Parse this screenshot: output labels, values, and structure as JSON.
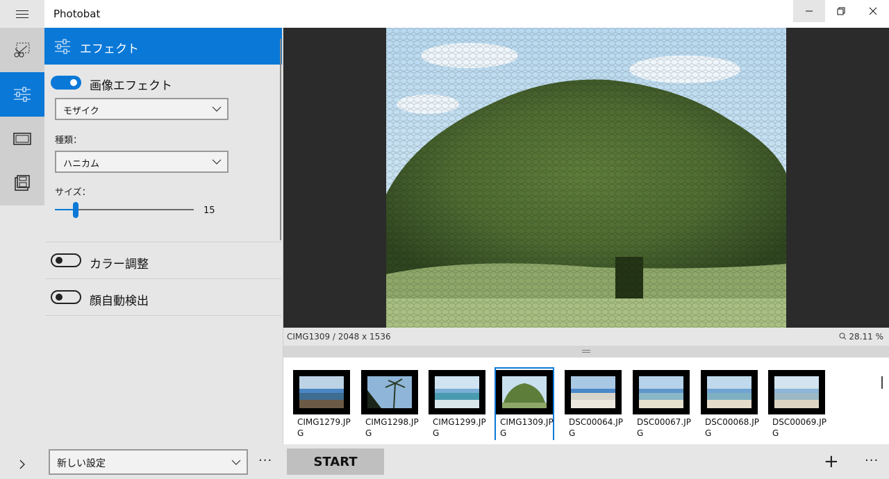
{
  "app": {
    "title": "Photobat"
  },
  "window_controls": {
    "minimize": "—",
    "restore": "❐",
    "close": "✕"
  },
  "rail": {
    "items": [
      {
        "name": "crop",
        "icon": "crop-icon",
        "active": false
      },
      {
        "name": "effects",
        "icon": "sliders-icon",
        "active": true
      },
      {
        "name": "frame",
        "icon": "frame-icon",
        "active": false
      },
      {
        "name": "save",
        "icon": "save-icon",
        "active": false
      }
    ],
    "expand_icon": "›"
  },
  "panel": {
    "header": "エフェクト",
    "image_effect": {
      "label": "画像エフェクト",
      "enabled": true,
      "effect_select": "モザイク",
      "type_label": "種類：",
      "type_select": "ハニカム",
      "size_label": "サイズ：",
      "size_value": "15",
      "size_level": 0.15
    },
    "color_adjust": {
      "label": "カラー調整",
      "enabled": false
    },
    "face_detect": {
      "label": "顔自動検出",
      "enabled": false
    }
  },
  "preset": {
    "value": "新しい設定",
    "more": "···"
  },
  "preview": {
    "info": "CIMG1309 / 2048 x 1536",
    "zoom": "28.11 %"
  },
  "filmstrip": {
    "items": [
      {
        "name_l1": "CIMG1279.JP",
        "name_l2": "G",
        "selected": false
      },
      {
        "name_l1": "CIMG1298.JP",
        "name_l2": "G",
        "selected": false
      },
      {
        "name_l1": "CIMG1299.JP",
        "name_l2": "G",
        "selected": false
      },
      {
        "name_l1": "CIMG1309.JP",
        "name_l2": "G",
        "selected": true
      },
      {
        "name_l1": "DSC00064.JP",
        "name_l2": "G",
        "selected": false
      },
      {
        "name_l1": "DSC00067.JP",
        "name_l2": "G",
        "selected": false
      },
      {
        "name_l1": "DSC00068.JP",
        "name_l2": "G",
        "selected": false
      },
      {
        "name_l1": "DSC00069.JP",
        "name_l2": "G",
        "selected": false
      }
    ]
  },
  "actions": {
    "start": "START",
    "add": "+",
    "more": "···"
  },
  "colors": {
    "accent": "#0a78d7"
  }
}
